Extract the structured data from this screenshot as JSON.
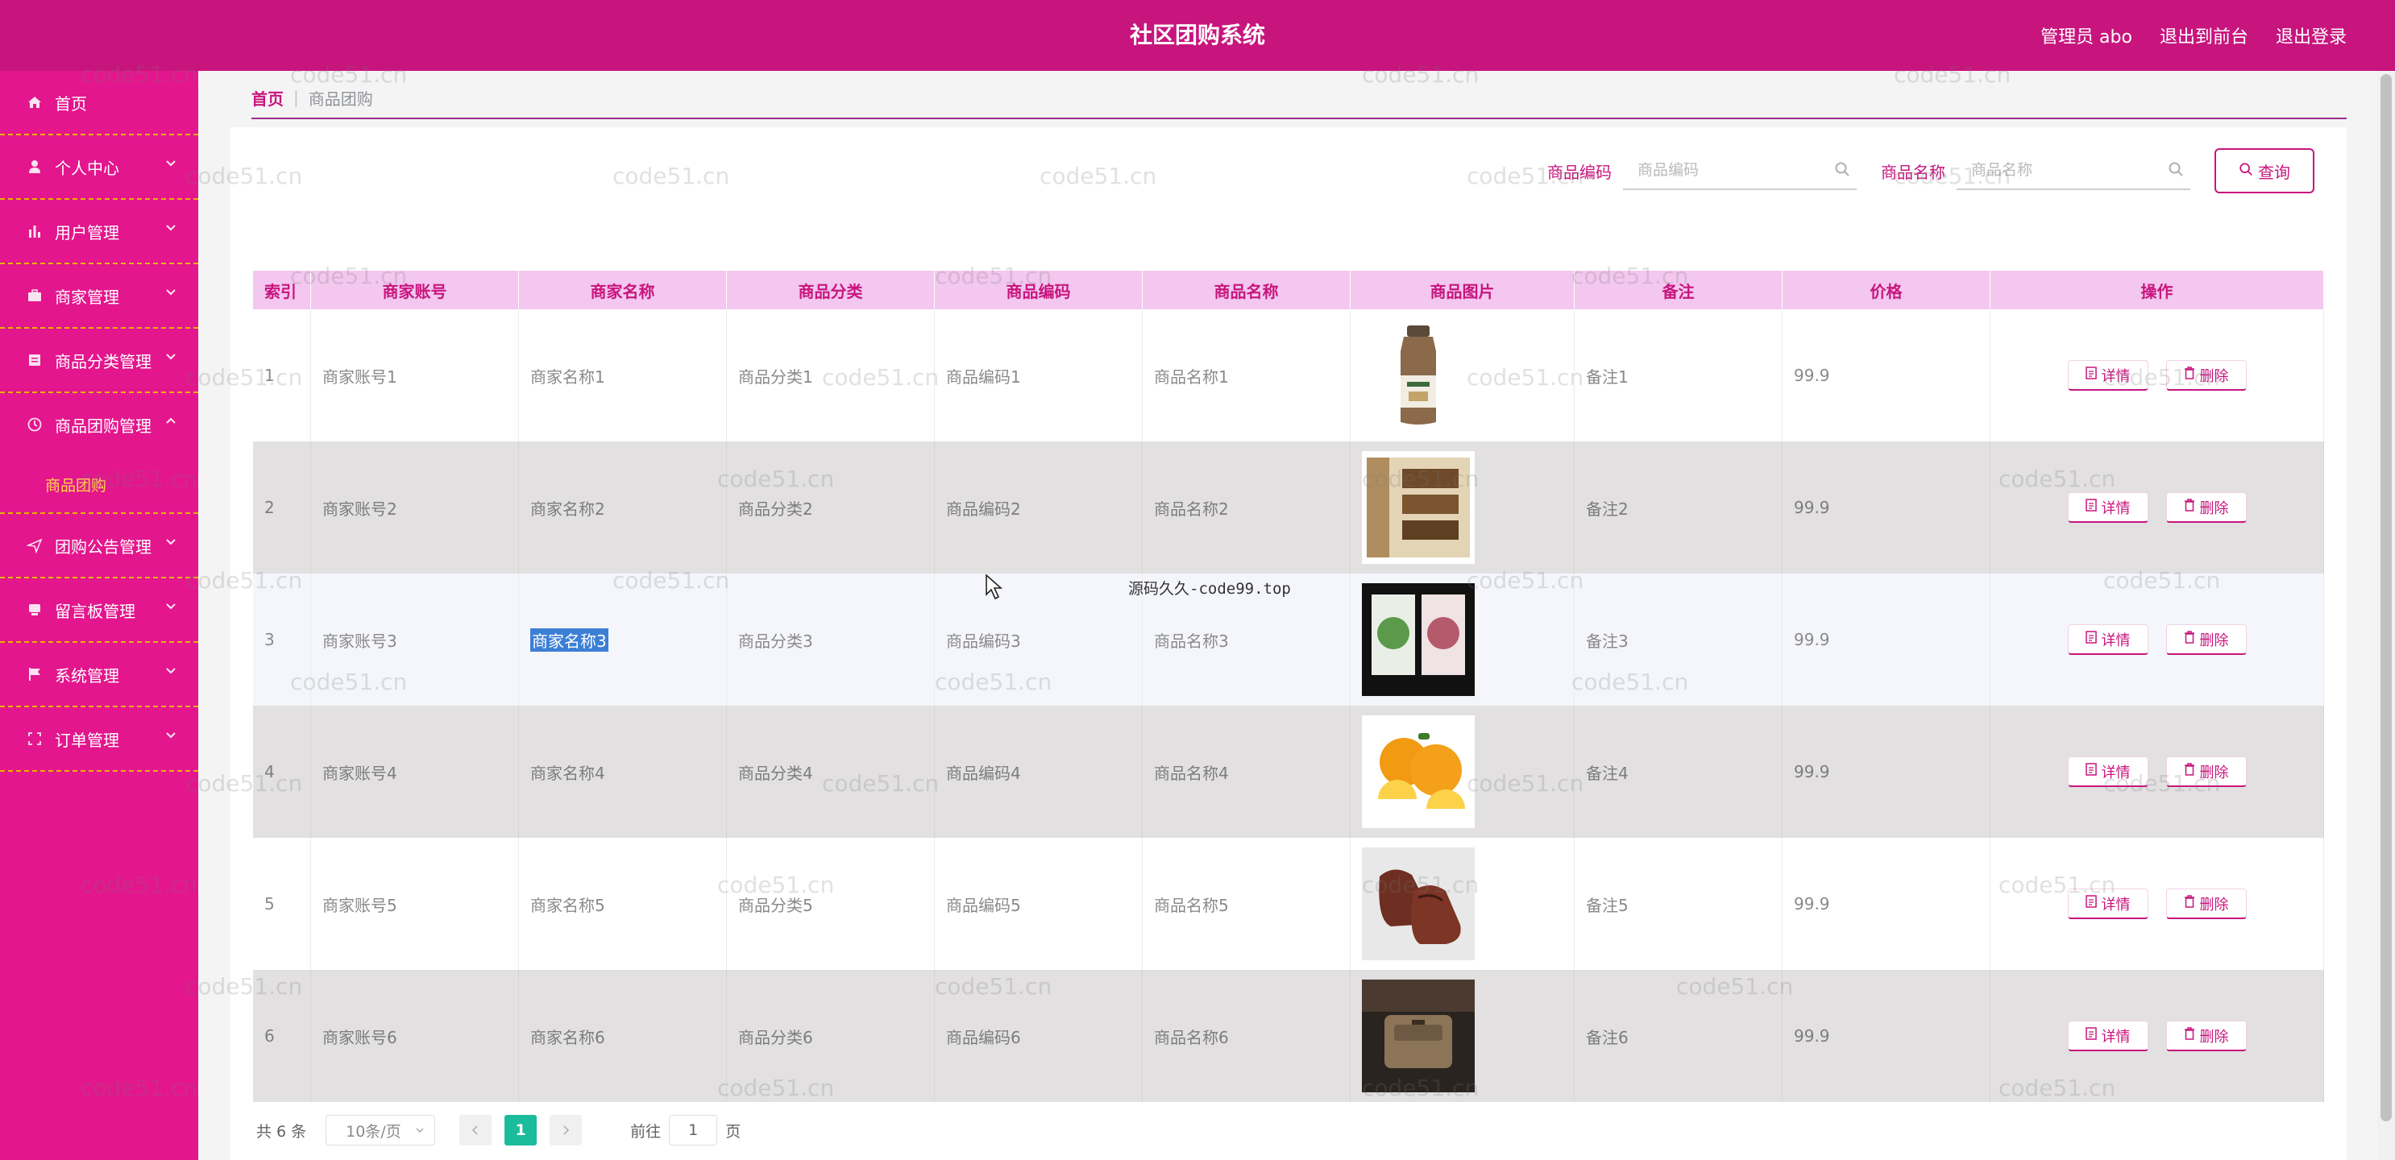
{
  "header": {
    "title": "社区团购系统",
    "admin_label": "管理员 abo",
    "back_label": "退出到前台",
    "logout_label": "退出登录"
  },
  "sidebar": {
    "items": [
      {
        "label": "首页",
        "icon": "home-icon",
        "expandable": false
      },
      {
        "label": "个人中心",
        "icon": "user-icon",
        "expandable": true
      },
      {
        "label": "用户管理",
        "icon": "bar-chart-icon",
        "expandable": true
      },
      {
        "label": "商家管理",
        "icon": "briefcase-icon",
        "expandable": true
      },
      {
        "label": "商品分类管理",
        "icon": "document-icon",
        "expandable": true
      },
      {
        "label": "商品团购管理",
        "icon": "clock-icon",
        "expandable": true,
        "expanded": true,
        "sub": [
          "商品团购"
        ]
      },
      {
        "label": "团购公告管理",
        "icon": "send-icon",
        "expandable": true
      },
      {
        "label": "留言板管理",
        "icon": "message-icon",
        "expandable": true
      },
      {
        "label": "系统管理",
        "icon": "flag-icon",
        "expandable": true
      },
      {
        "label": "订单管理",
        "icon": "frame-icon",
        "expandable": true
      }
    ],
    "active_sub": "商品团购"
  },
  "breadcrumb": {
    "home": "首页",
    "separator": "|",
    "current": "商品团购"
  },
  "search": {
    "code_label": "商品编码",
    "code_placeholder": "商品编码",
    "name_label": "商品名称",
    "name_placeholder": "商品名称",
    "button_label": "查询"
  },
  "table": {
    "headers": [
      "索引",
      "商家账号",
      "商家名称",
      "商品分类",
      "商品编码",
      "商品名称",
      "商品图片",
      "备注",
      "价格",
      "操作"
    ],
    "rows": [
      {
        "index": "1",
        "account": "商家账号1",
        "name": "商家名称1",
        "category": "商品分类1",
        "code": "商品编码1",
        "product": "商品名称1",
        "image": "bottle-drink",
        "note": "备注1",
        "price": "99.9"
      },
      {
        "index": "2",
        "account": "商家账号2",
        "name": "商家名称2",
        "category": "商品分类2",
        "code": "商品编码2",
        "product": "商品名称2",
        "image": "book-box",
        "note": "备注2",
        "price": "99.9"
      },
      {
        "index": "3",
        "account": "商家账号3",
        "name": "商家名称3",
        "category": "商品分类3",
        "code": "商品编码3",
        "product": "商品名称3",
        "image": "tea-packs",
        "note": "备注3",
        "price": "99.9",
        "selected_field": "name"
      },
      {
        "index": "4",
        "account": "商家账号4",
        "name": "商家名称4",
        "category": "商品分类4",
        "code": "商品编码4",
        "product": "商品名称4",
        "image": "oranges",
        "note": "备注4",
        "price": "99.9"
      },
      {
        "index": "5",
        "account": "商家账号5",
        "name": "商家名称5",
        "category": "商品分类5",
        "code": "商品编码5",
        "product": "商品名称5",
        "image": "leather-shoes",
        "note": "备注5",
        "price": "99.9"
      },
      {
        "index": "6",
        "account": "商家账号6",
        "name": "商家名称6",
        "category": "商品分类6",
        "code": "商品编码6",
        "product": "商品名称6",
        "image": "waist-bag",
        "note": "备注6",
        "price": "99.9"
      }
    ],
    "detail_label": "详情",
    "delete_label": "删除"
  },
  "pagination": {
    "total_label": "共 6 条",
    "page_size": "10条/页",
    "current_page": "1",
    "goto_label": "前往",
    "goto_value": "1",
    "page_unit": "页"
  },
  "overlay": {
    "watermark": "code51.cn",
    "center_text": "源码久久-code99.top"
  },
  "colors": {
    "header": "#c8157e",
    "sidebar": "#e3168d",
    "accent": "#c8157e",
    "table_header": "#f3c7ef",
    "page_active": "#1bbc9b",
    "divider": "#e8b400"
  }
}
